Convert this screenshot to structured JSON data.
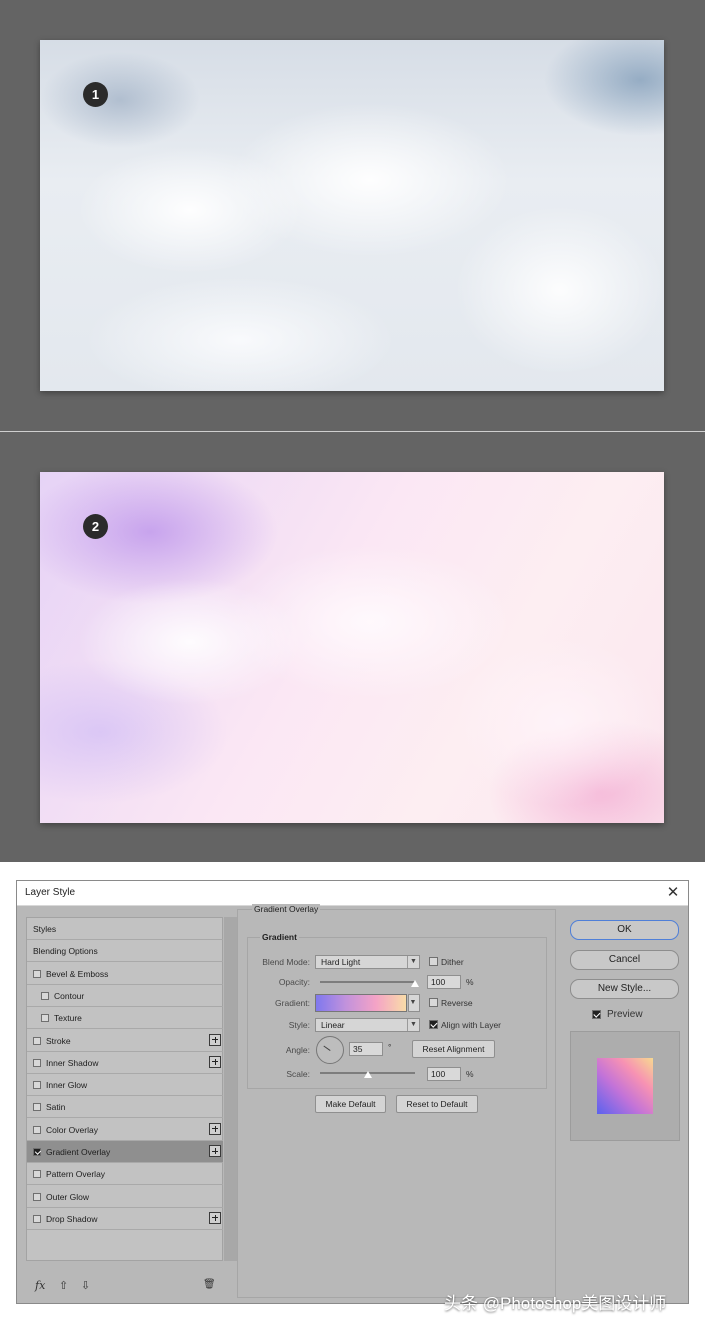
{
  "figures": [
    {
      "step": "1"
    },
    {
      "step": "2"
    }
  ],
  "dialog": {
    "title": "Layer Style",
    "close": "✕",
    "styles_list": [
      {
        "label": "Styles",
        "checkbox": false,
        "checked": false,
        "plus": false,
        "indent": false
      },
      {
        "label": "Blending Options",
        "checkbox": false,
        "checked": false,
        "plus": false,
        "indent": false
      },
      {
        "label": "Bevel & Emboss",
        "checkbox": true,
        "checked": false,
        "plus": false,
        "indent": false
      },
      {
        "label": "Contour",
        "checkbox": true,
        "checked": false,
        "plus": false,
        "indent": true
      },
      {
        "label": "Texture",
        "checkbox": true,
        "checked": false,
        "plus": false,
        "indent": true
      },
      {
        "label": "Stroke",
        "checkbox": true,
        "checked": false,
        "plus": true,
        "indent": false
      },
      {
        "label": "Inner Shadow",
        "checkbox": true,
        "checked": false,
        "plus": true,
        "indent": false
      },
      {
        "label": "Inner Glow",
        "checkbox": true,
        "checked": false,
        "plus": false,
        "indent": false
      },
      {
        "label": "Satin",
        "checkbox": true,
        "checked": false,
        "plus": false,
        "indent": false
      },
      {
        "label": "Color Overlay",
        "checkbox": true,
        "checked": false,
        "plus": true,
        "indent": false
      },
      {
        "label": "Gradient Overlay",
        "checkbox": true,
        "checked": true,
        "plus": true,
        "indent": false,
        "selected": true
      },
      {
        "label": "Pattern Overlay",
        "checkbox": true,
        "checked": false,
        "plus": false,
        "indent": false
      },
      {
        "label": "Outer Glow",
        "checkbox": true,
        "checked": false,
        "plus": false,
        "indent": false
      },
      {
        "label": "Drop Shadow",
        "checkbox": true,
        "checked": false,
        "plus": true,
        "indent": false
      }
    ],
    "bottom_icons": {
      "fx": "fx",
      "up": "⇧",
      "down": "⇩",
      "trash": "🗑"
    },
    "gradient_overlay": {
      "section_title": "Gradient Overlay",
      "group_title": "Gradient",
      "blend_mode_label": "Blend Mode:",
      "blend_mode_value": "Hard Light",
      "dither_label": "Dither",
      "dither_checked": false,
      "opacity_label": "Opacity:",
      "opacity_value": "100",
      "opacity_unit": "%",
      "opacity_level": 1.0,
      "gradient_label": "Gradient:",
      "gradient_colors": [
        "#7f78ee",
        "#c292dc",
        "#f4a3c6",
        "#f9dca8"
      ],
      "reverse_label": "Reverse",
      "reverse_checked": false,
      "style_label": "Style:",
      "style_value": "Linear",
      "align_label": "Align with Layer",
      "align_checked": true,
      "angle_label": "Angle:",
      "angle_value": "35",
      "angle_unit": "°",
      "reset_alignment": "Reset Alignment",
      "scale_label": "Scale:",
      "scale_value": "100",
      "scale_unit": "%",
      "scale_level": 0.5,
      "make_default": "Make Default",
      "reset_default": "Reset to Default"
    },
    "buttons": {
      "ok": "OK",
      "cancel": "Cancel",
      "new_style": "New Style..."
    },
    "preview_label": "Preview",
    "preview_checked": true
  },
  "watermark": "头条 @Photoshop美图设计师"
}
